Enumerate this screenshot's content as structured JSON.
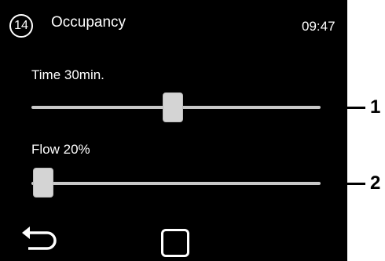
{
  "header": {
    "page_number": "14",
    "title": "Occupancy",
    "time": "09:47"
  },
  "sliders": [
    {
      "label": "Time 30min.",
      "value": 0.49
    },
    {
      "label": "Flow 20%",
      "value": 0.04
    }
  ],
  "footer": {
    "back_icon": "back-arrow-icon",
    "home_icon": "home-square-icon"
  },
  "callouts": [
    "1",
    "2"
  ]
}
